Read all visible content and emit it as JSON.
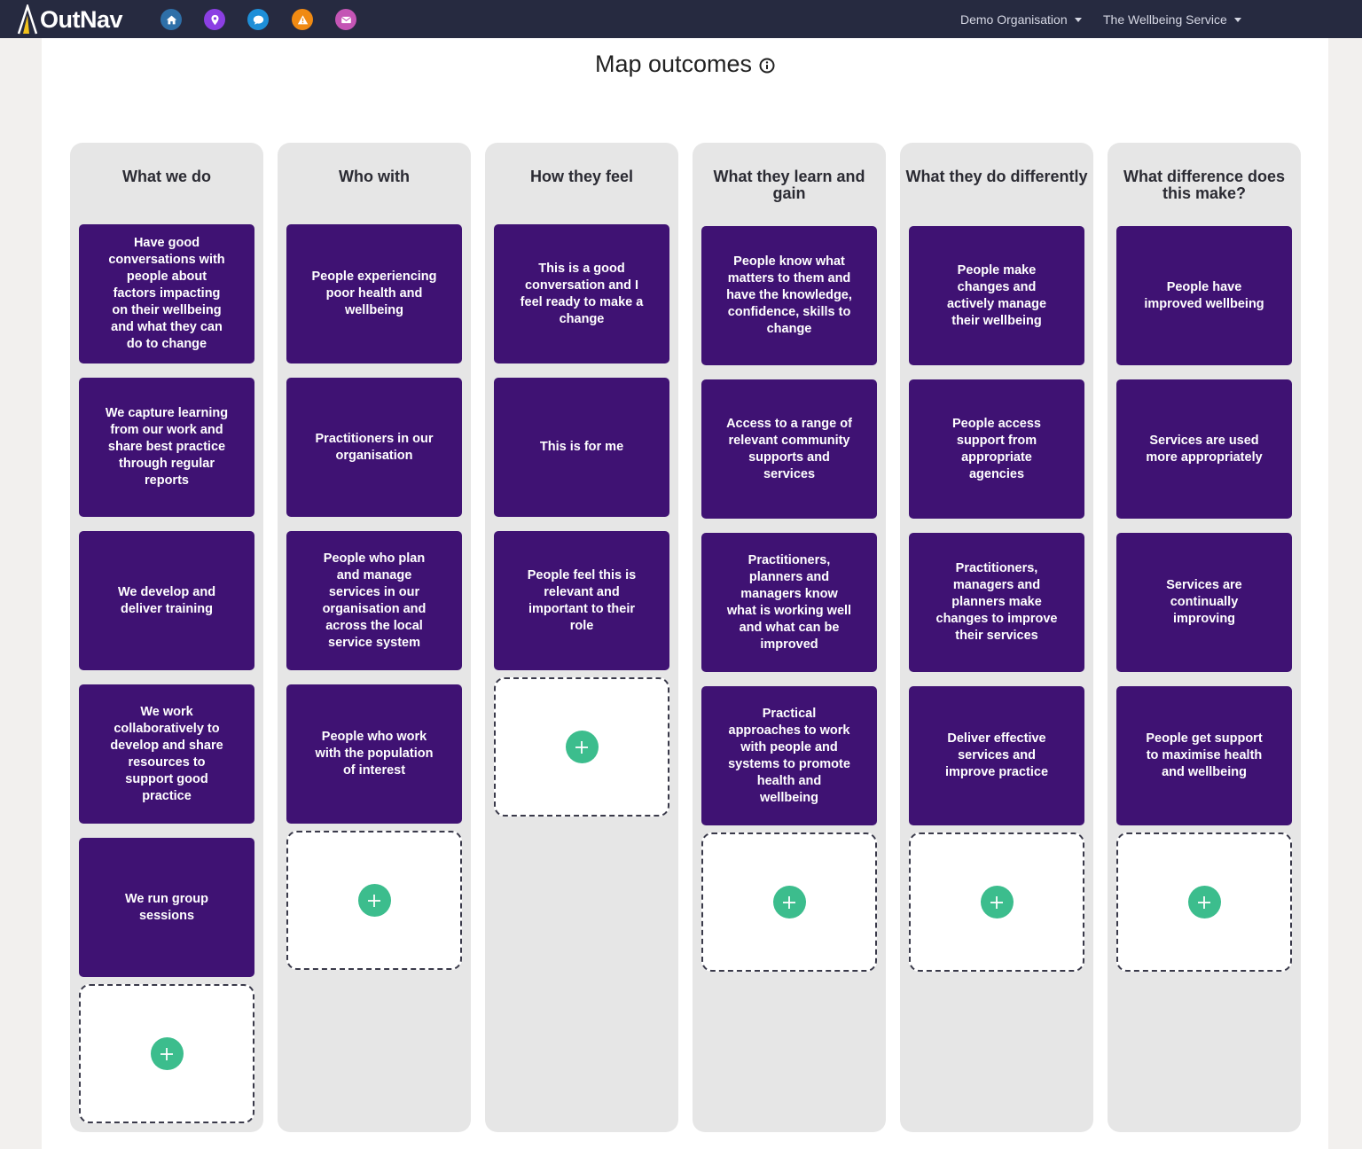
{
  "app": {
    "name": "OutNav"
  },
  "nav": {
    "icons": [
      {
        "name": "home-icon",
        "color": "#2e6fa8"
      },
      {
        "name": "map-pin-icon",
        "color": "#8b3fe3"
      },
      {
        "name": "chat-icon",
        "color": "#1e8fd8"
      },
      {
        "name": "warning-icon",
        "color": "#f08a12"
      },
      {
        "name": "mail-icon",
        "color": "#c455b5"
      }
    ],
    "organisation": "Demo Organisation",
    "service": "The Wellbeing Service"
  },
  "page": {
    "title": "Map outcomes"
  },
  "colors": {
    "card": "#3f1273",
    "add": "#3cbd8d",
    "column": "#e6e6e6",
    "navbar": "#262a40"
  },
  "columns": [
    {
      "title": "What we do",
      "cards": [
        "Have good conversations with people about factors impacting on their wellbeing and what they can do to change",
        "We capture learning from our work and share best practice through regular reports",
        "We develop and deliver training",
        "We work collaboratively to develop and share resources to support good practice",
        "We run group sessions"
      ]
    },
    {
      "title": "Who with",
      "cards": [
        "People experiencing poor health and wellbeing",
        "Practitioners in our organisation",
        "People who plan and manage services in our organisation and across the local service system",
        "People who work with the population of interest"
      ]
    },
    {
      "title": "How they feel",
      "cards": [
        "This is a good conversation and I feel ready to make a change",
        "This is for me",
        "People feel this is relevant and important to their role"
      ]
    },
    {
      "title": "What they learn and gain",
      "cards": [
        "People know what matters to them and have the knowledge, confidence, skills to change",
        "Access to a range of relevant community supports and services",
        "Practitioners, planners and managers know what is working well and what can be improved",
        "Practical approaches to work with people and systems to promote health and wellbeing"
      ]
    },
    {
      "title": "What they do differently",
      "cards": [
        "People make changes and actively manage their wellbeing",
        "People access support from appropriate agencies",
        "Practitioners, managers and planners make changes to improve their services",
        "Deliver effective services and improve practice"
      ]
    },
    {
      "title": "What difference does this make?",
      "cards": [
        "People have improved wellbeing",
        "Services are used more appropriately",
        "Services are continually improving",
        "People get support to maximise health and wellbeing"
      ]
    }
  ]
}
